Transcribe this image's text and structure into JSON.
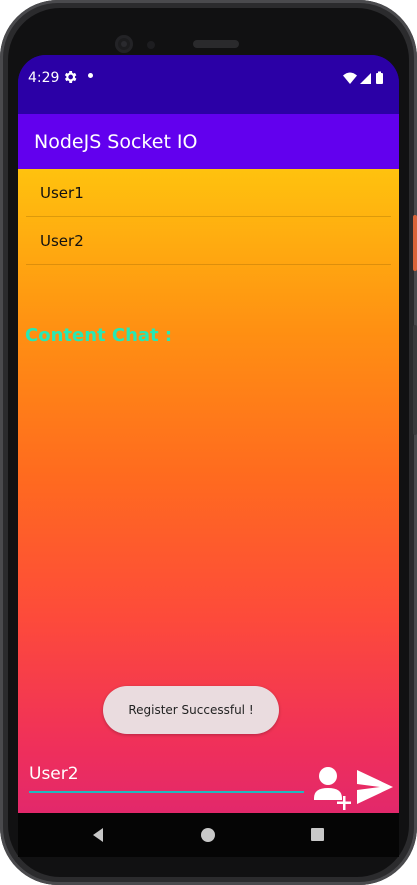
{
  "status_bar": {
    "time": "4:29",
    "icons": [
      "settings-icon",
      "notification-dot-icon",
      "wifi-icon",
      "signal-icon",
      "battery-icon"
    ]
  },
  "app_bar": {
    "title": "NodeJS Socket IO"
  },
  "users": [
    {
      "name": "User1"
    },
    {
      "name": "User2"
    }
  ],
  "chat": {
    "label": "Content Chat :"
  },
  "input": {
    "value": "User2",
    "buttons": [
      "add-user-icon",
      "send-icon"
    ]
  },
  "toast": {
    "message": "Register Successful !"
  },
  "nav_bar": {
    "icons": [
      "back-icon",
      "home-icon",
      "recents-icon"
    ]
  },
  "colors": {
    "status_bar": "#2b00a6",
    "app_bar": "#6200ee",
    "gradient_top": "#ffc20e",
    "gradient_bottom": "#e2286b",
    "chat_label": "#27e8b4",
    "input_underline": "#20b8c0"
  }
}
